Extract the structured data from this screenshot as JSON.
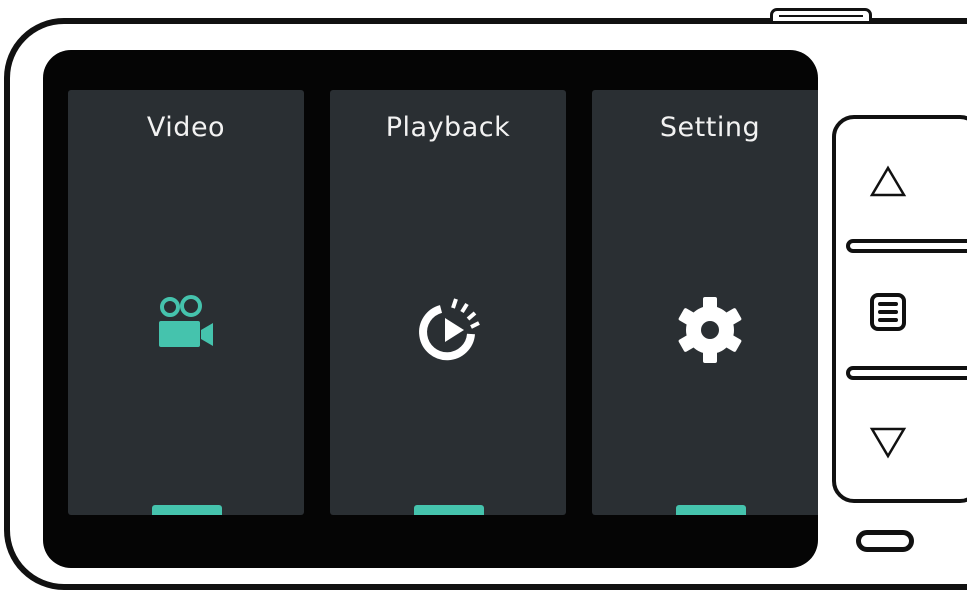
{
  "menu": {
    "tiles": [
      {
        "label": "Video",
        "icon": "video-camera-icon"
      },
      {
        "label": "Playback",
        "icon": "playback-timer-icon"
      },
      {
        "label": "Setting",
        "icon": "gear-icon"
      }
    ]
  },
  "colors": {
    "accent": "#45c3ad",
    "tile_background": "#2a2f33",
    "screen_background": "#050505",
    "label": "#f2f2f2"
  },
  "controls": {
    "up_icon": "up-triangle-icon",
    "menu_icon": "menu-icon",
    "down_icon": "down-triangle-icon"
  }
}
